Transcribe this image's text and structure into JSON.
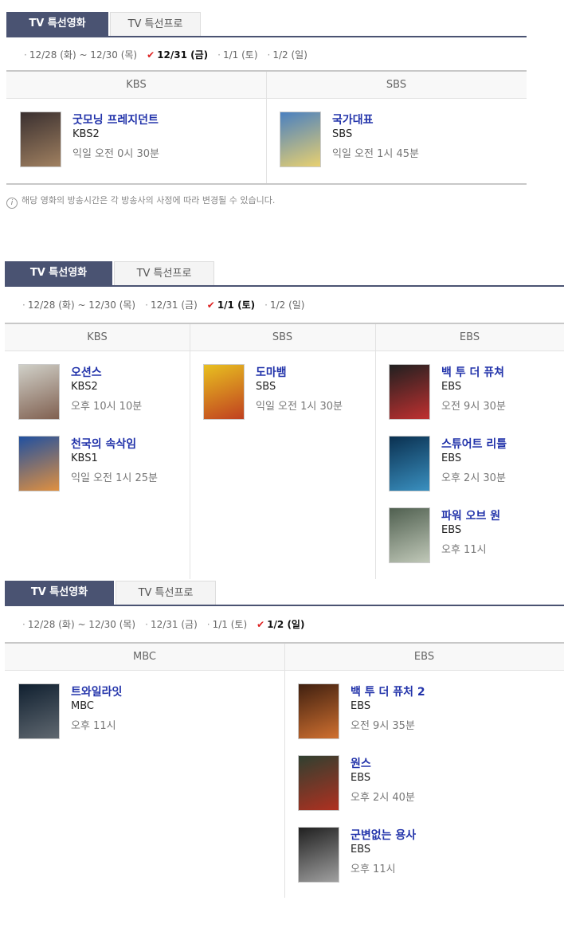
{
  "tabs": {
    "movie": "TV 특선영화",
    "program": "TV 특선프로"
  },
  "panels": [
    {
      "dates": [
        {
          "label": "12/28 (화) ~ 12/30 (목)",
          "selected": false
        },
        {
          "label": "12/31 (금)",
          "selected": true
        },
        {
          "label": "1/1 (토)",
          "selected": false
        },
        {
          "label": "1/2 (일)",
          "selected": false
        }
      ],
      "columns": [
        {
          "name": "KBS",
          "items": [
            {
              "title": "굿모닝 프레지던트",
              "channel": "KBS2",
              "time": "익일 오전 0시 30분",
              "poster_icon": "movie-poster"
            }
          ]
        },
        {
          "name": "SBS",
          "items": [
            {
              "title": "국가대표",
              "channel": "SBS",
              "time": "익일 오전 1시 45분",
              "poster_icon": "movie-poster"
            }
          ]
        }
      ],
      "notice": "해당 영화의 방송시간은 각 방송사의 사정에 따라 변경될 수 있습니다."
    },
    {
      "dates": [
        {
          "label": "12/28 (화) ~ 12/30 (목)",
          "selected": false
        },
        {
          "label": "12/31 (금)",
          "selected": false
        },
        {
          "label": "1/1 (토)",
          "selected": true
        },
        {
          "label": "1/2 (일)",
          "selected": false
        }
      ],
      "columns": [
        {
          "name": "KBS",
          "items": [
            {
              "title": "오션스",
              "channel": "KBS2",
              "time": "오후 10시 10분",
              "poster_icon": "movie-poster"
            },
            {
              "title": "천국의 속삭임",
              "channel": "KBS1",
              "time": "익일 오전 1시 25분",
              "poster_icon": "movie-poster"
            }
          ]
        },
        {
          "name": "SBS",
          "items": [
            {
              "title": "도마뱀",
              "channel": "SBS",
              "time": "익일 오전 1시 30분",
              "poster_icon": "movie-poster"
            }
          ]
        },
        {
          "name": "EBS",
          "items": [
            {
              "title": "백 투 더 퓨쳐",
              "channel": "EBS",
              "time": "오전 9시 30분",
              "poster_icon": "movie-poster"
            },
            {
              "title": "스튜어트 리틀",
              "channel": "EBS",
              "time": "오후 2시 30분",
              "poster_icon": "movie-poster"
            },
            {
              "title": "파워 오브 원",
              "channel": "EBS",
              "time": "오후 11시",
              "poster_icon": "movie-poster"
            }
          ]
        }
      ]
    },
    {
      "dates": [
        {
          "label": "12/28 (화) ~ 12/30 (목)",
          "selected": false
        },
        {
          "label": "12/31 (금)",
          "selected": false
        },
        {
          "label": "1/1 (토)",
          "selected": false
        },
        {
          "label": "1/2 (일)",
          "selected": true
        }
      ],
      "columns": [
        {
          "name": "MBC",
          "items": [
            {
              "title": "트와일라잇",
              "channel": "MBC",
              "time": "오후 11시",
              "poster_icon": "movie-poster"
            }
          ]
        },
        {
          "name": "EBS",
          "items": [
            {
              "title": "백 투 더 퓨처 2",
              "channel": "EBS",
              "time": "오전 9시 35분",
              "poster_icon": "movie-poster"
            },
            {
              "title": "원스",
              "channel": "EBS",
              "time": "오후 2시 40분",
              "poster_icon": "movie-poster"
            },
            {
              "title": "군변없는 용사",
              "channel": "EBS",
              "time": "오후 11시",
              "poster_icon": "movie-poster"
            }
          ]
        }
      ]
    }
  ]
}
